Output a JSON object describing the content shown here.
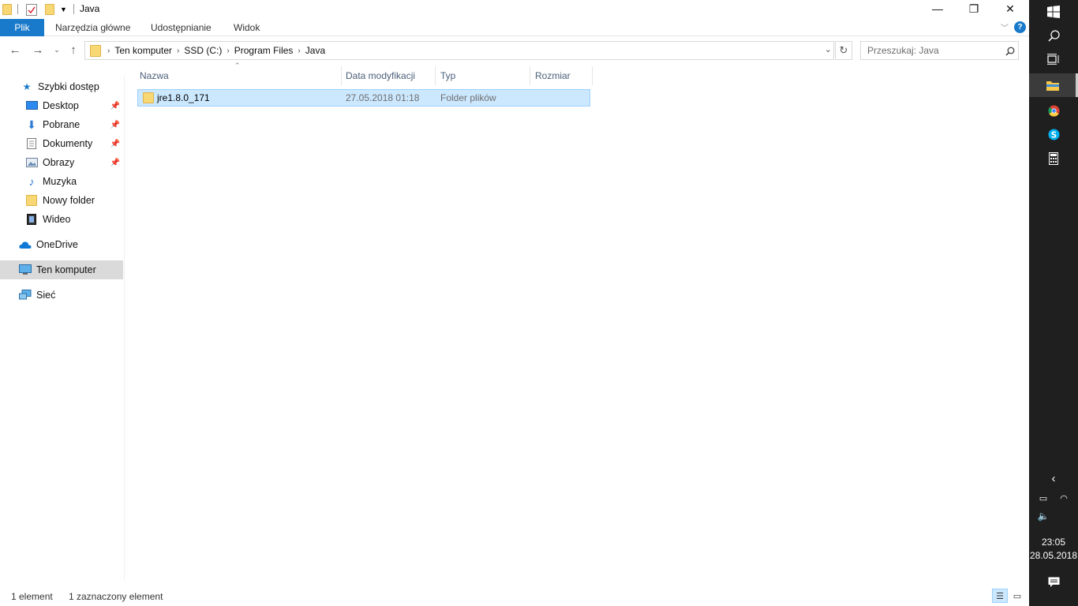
{
  "window": {
    "title": "Java",
    "controls": {
      "minimize": "—",
      "maximize": "❐",
      "close": "✕"
    }
  },
  "ribbon": {
    "tabs": [
      "Plik",
      "Narzędzia główne",
      "Udostępnianie",
      "Widok"
    ],
    "help": "?"
  },
  "address": {
    "crumbs": [
      "Ten komputer",
      "SSD (C:)",
      "Program Files",
      "Java"
    ],
    "search_placeholder": "Przeszukaj: Java"
  },
  "nav": {
    "quick_access": "Szybki dostęp",
    "items": [
      {
        "label": "Desktop",
        "icon": "desktop-icon",
        "pinned": true
      },
      {
        "label": "Pobrane",
        "icon": "download-icon",
        "pinned": true
      },
      {
        "label": "Dokumenty",
        "icon": "documents-icon",
        "pinned": true
      },
      {
        "label": "Obrazy",
        "icon": "pictures-icon",
        "pinned": true
      },
      {
        "label": "Muzyka",
        "icon": "music-icon",
        "pinned": false
      },
      {
        "label": "Nowy folder",
        "icon": "folder-icon",
        "pinned": false
      },
      {
        "label": "Wideo",
        "icon": "video-icon",
        "pinned": false
      }
    ],
    "onedrive": "OneDrive",
    "this_pc": "Ten komputer",
    "network": "Sieć"
  },
  "columns": [
    "Nazwa",
    "Data modyfikacji",
    "Typ",
    "Rozmiar"
  ],
  "files": [
    {
      "name": "jre1.8.0_171",
      "modified": "27.05.2018 01:18",
      "type": "Folder plików",
      "size": ""
    }
  ],
  "status": {
    "count": "1 element",
    "selected": "1 zaznaczony element"
  },
  "taskbar": {
    "time": "23:05",
    "date": "28.05.2018"
  },
  "colors": {
    "accent": "#1979ca",
    "selection": "#cce8ff",
    "taskbar": "#1f1f1f"
  }
}
